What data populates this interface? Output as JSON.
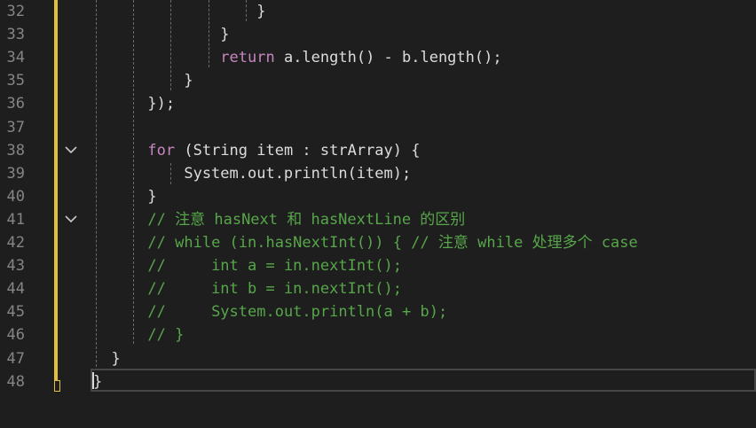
{
  "editor": {
    "colors": {
      "background": "#1e1e1e",
      "keyword": "#c586c0",
      "comment": "#57a64a",
      "text": "#dcdcdc",
      "line_number": "#858585",
      "change_marker": "#e2c03b"
    },
    "current_line": 48,
    "lines": [
      {
        "num": "32",
        "fold": false,
        "tokens": [
          {
            "t": "tx",
            "s": "                  }"
          }
        ]
      },
      {
        "num": "33",
        "fold": false,
        "tokens": [
          {
            "t": "tx",
            "s": "              }"
          }
        ]
      },
      {
        "num": "34",
        "fold": false,
        "tokens": [
          {
            "t": "tx",
            "s": "              "
          },
          {
            "t": "kw",
            "s": "return"
          },
          {
            "t": "tx",
            "s": " a.length() - b.length();"
          }
        ]
      },
      {
        "num": "35",
        "fold": false,
        "tokens": [
          {
            "t": "tx",
            "s": "          }"
          }
        ]
      },
      {
        "num": "36",
        "fold": false,
        "tokens": [
          {
            "t": "tx",
            "s": "      });"
          }
        ]
      },
      {
        "num": "37",
        "fold": false,
        "tokens": [
          {
            "t": "tx",
            "s": ""
          }
        ]
      },
      {
        "num": "38",
        "fold": true,
        "tokens": [
          {
            "t": "tx",
            "s": "      "
          },
          {
            "t": "kw",
            "s": "for"
          },
          {
            "t": "tx",
            "s": " (String item : strArray) {"
          }
        ]
      },
      {
        "num": "39",
        "fold": false,
        "tokens": [
          {
            "t": "tx",
            "s": "          System.out.println(item);"
          }
        ]
      },
      {
        "num": "40",
        "fold": false,
        "tokens": [
          {
            "t": "tx",
            "s": "      }"
          }
        ]
      },
      {
        "num": "41",
        "fold": true,
        "tokens": [
          {
            "t": "tx",
            "s": "      "
          },
          {
            "t": "cm",
            "s": "// 注意 hasNext 和 hasNextLine 的区别"
          }
        ]
      },
      {
        "num": "42",
        "fold": false,
        "tokens": [
          {
            "t": "tx",
            "s": "      "
          },
          {
            "t": "cm",
            "s": "// while (in.hasNextInt()) { // 注意 while 处理多个 case"
          }
        ]
      },
      {
        "num": "43",
        "fold": false,
        "tokens": [
          {
            "t": "tx",
            "s": "      "
          },
          {
            "t": "cm",
            "s": "//     int a = in.nextInt();"
          }
        ]
      },
      {
        "num": "44",
        "fold": false,
        "tokens": [
          {
            "t": "tx",
            "s": "      "
          },
          {
            "t": "cm",
            "s": "//     int b = in.nextInt();"
          }
        ]
      },
      {
        "num": "45",
        "fold": false,
        "tokens": [
          {
            "t": "tx",
            "s": "      "
          },
          {
            "t": "cm",
            "s": "//     System.out.println(a + b);"
          }
        ]
      },
      {
        "num": "46",
        "fold": false,
        "tokens": [
          {
            "t": "tx",
            "s": "      "
          },
          {
            "t": "cm",
            "s": "// }"
          }
        ]
      },
      {
        "num": "47",
        "fold": false,
        "tokens": [
          {
            "t": "tx",
            "s": "  }"
          }
        ]
      },
      {
        "num": "48",
        "fold": false,
        "tokens": [
          {
            "t": "tx",
            "s": "}"
          }
        ]
      }
    ]
  }
}
